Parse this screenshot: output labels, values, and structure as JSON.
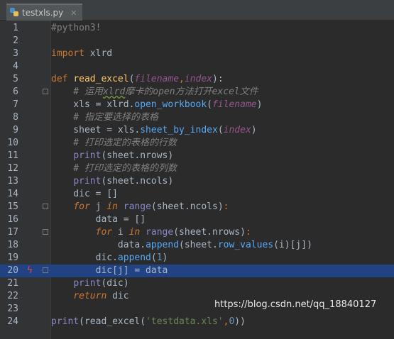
{
  "tab": {
    "filename": "testxls.py",
    "close": "✕",
    "icon": "python-file-icon"
  },
  "lines": {
    "n": [
      "1",
      "2",
      "3",
      "4",
      "5",
      "6",
      "7",
      "8",
      "9",
      "10",
      "11",
      "12",
      "13",
      "14",
      "15",
      "16",
      "17",
      "18",
      "19",
      "20",
      "21",
      "22",
      "23",
      "24"
    ]
  },
  "code": {
    "l1": "#python3!",
    "l3a": "import",
    "l3b": " xlrd",
    "l5a": "def",
    "l5b": " ",
    "l5c": "read_excel",
    "l5d": "(",
    "l5e": "filename",
    "l5f": ",",
    "l5g": "index",
    "l5h": "):",
    "l6a": "    # 运用",
    "l6b": "xlrd",
    "l6c": "摩卡的open方法打开excel文件",
    "l7a": "    xls = xlrd.",
    "l7b": "open_workbook",
    "l7c": "(",
    "l7d": "filename",
    "l7e": ")",
    "l8": "    # 指定要选择的表格",
    "l9a": "    sheet = xls.",
    "l9b": "sheet_by_index",
    "l9c": "(",
    "l9d": "index",
    "l9e": ")",
    "l10": "    # 打印选定的表格的行数",
    "l11a": "    ",
    "l11b": "print",
    "l11c": "(sheet.nrows)",
    "l12": "    # 打印选定的表格的列数",
    "l13a": "    ",
    "l13b": "print",
    "l13c": "(sheet.ncols)",
    "l14": "    dic = []",
    "l15a": "    ",
    "l15b": "for",
    "l15c": " j ",
    "l15d": "in",
    "l15e": " ",
    "l15f": "range",
    "l15g": "(sheet.ncols)",
    "l15h": ":",
    "l16": "        data = []",
    "l17a": "        ",
    "l17b": "for",
    "l17c": " i ",
    "l17d": "in",
    "l17e": " ",
    "l17f": "range",
    "l17g": "(sheet.nrows)",
    "l17h": ":",
    "l18a": "            data.",
    "l18b": "append",
    "l18c": "(sheet.",
    "l18d": "row_values",
    "l18e": "(i)[j])",
    "l19a": "        dic.",
    "l19b": "append",
    "l19c": "(",
    "l19d": "1",
    "l19e": ")",
    "l20": "        dic[j] = data",
    "l21a": "    ",
    "l21b": "print",
    "l21c": "(dic)",
    "l22a": "    ",
    "l22b": "return",
    "l22c": " dic",
    "l24a": "print",
    "l24b": "(read_excel(",
    "l24c": "'testdata.xls'",
    "l24d": ",",
    "l24e": "0",
    "l24f": "))"
  },
  "watermark": "https://blog.csdn.net/qq_18840127",
  "colors": {
    "background": "#2b2b2b",
    "gutter": "#313335",
    "highlight": "#214283",
    "keyword": "#cc7832",
    "function": "#ffc66d",
    "comment": "#808080",
    "number": "#6897bb",
    "string": "#6a8759",
    "builtin": "#8888c6"
  }
}
